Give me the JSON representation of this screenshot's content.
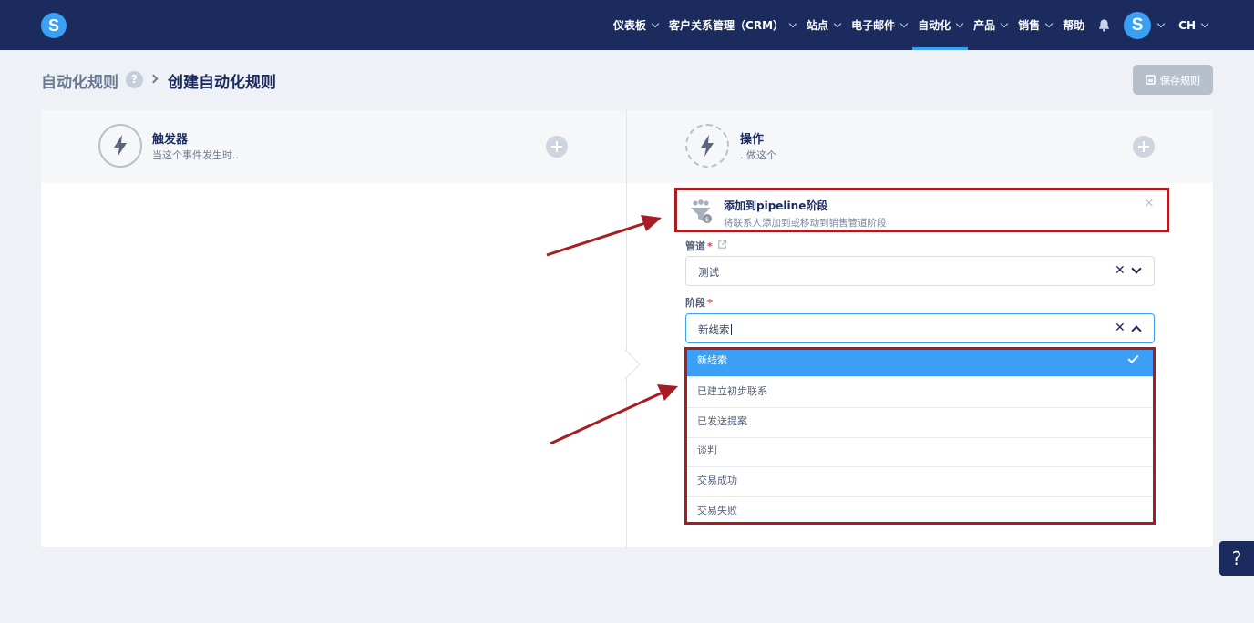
{
  "topbar": {
    "logo_letter": "S",
    "nav": [
      {
        "label": "仪表板",
        "has_menu": true
      },
      {
        "label": "客户关系管理（CRM）",
        "has_menu": true
      },
      {
        "label": "站点",
        "has_menu": true
      },
      {
        "label": "电子邮件",
        "has_menu": true
      },
      {
        "label": "自动化",
        "has_menu": true,
        "active": true
      },
      {
        "label": "产品",
        "has_menu": true
      },
      {
        "label": "销售",
        "has_menu": true
      },
      {
        "label": "帮助",
        "has_menu": false
      }
    ],
    "avatar_letter": "S",
    "language": "CH"
  },
  "breadcrumb": {
    "parent": "自动化规则",
    "help": "?",
    "current": "创建自动化规则"
  },
  "save_button": {
    "label": "保存规则",
    "enabled": false
  },
  "trigger": {
    "title": "触发器",
    "subtitle": "当这个事件发生时.."
  },
  "action_col": {
    "title": "操作",
    "subtitle": "..做这个"
  },
  "action": {
    "title": "添加到pipeline阶段",
    "description": "将联系人添加到或移动到销售管道阶段",
    "close": "×"
  },
  "pipeline_field": {
    "label": "管道",
    "required": "*",
    "value": "测试"
  },
  "stage_field": {
    "label": "阶段",
    "required": "*",
    "value": "新线索"
  },
  "stage_options": [
    {
      "label": "新线索",
      "selected": true
    },
    {
      "label": "已建立初步联系",
      "selected": false
    },
    {
      "label": "已发送提案",
      "selected": false
    },
    {
      "label": "谈判",
      "selected": false
    },
    {
      "label": "交易成功",
      "selected": false
    },
    {
      "label": "交易失败",
      "selected": false
    }
  ],
  "help_fab": "?",
  "colors": {
    "navy": "#1b2b5e",
    "accent": "#3b9ff5",
    "highlight": "#a81d22"
  }
}
